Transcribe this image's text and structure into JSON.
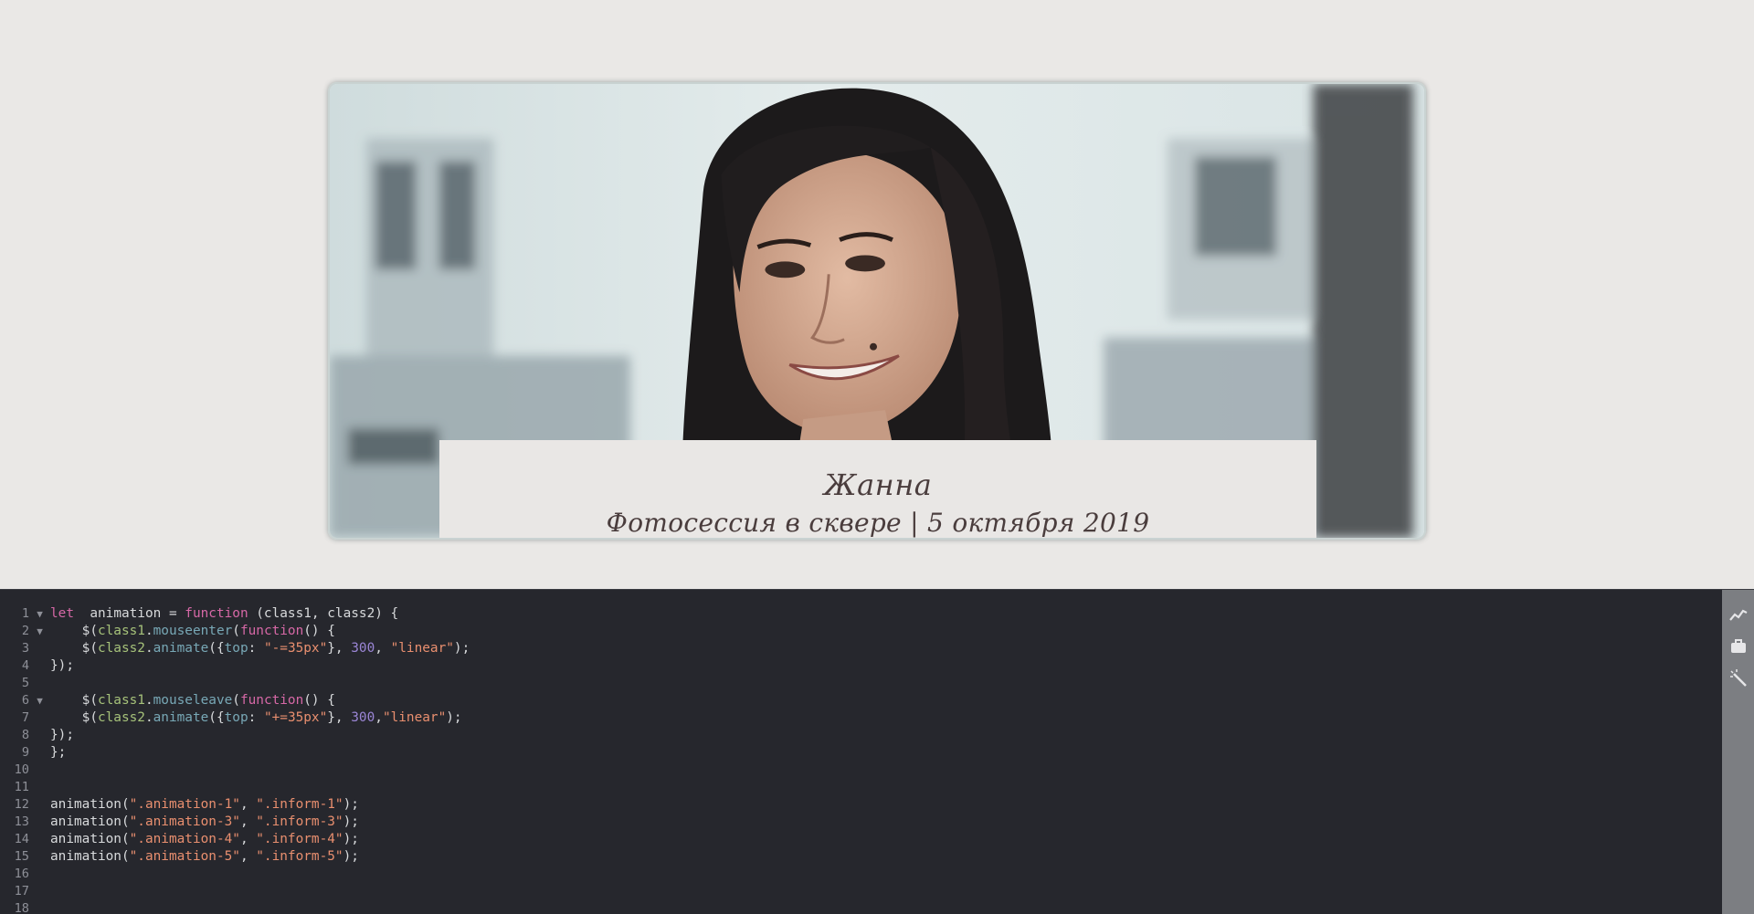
{
  "preview": {
    "name": "Жанна",
    "subtitle": "Фотосессия в сквере | 5 октября 2019"
  },
  "editor": {
    "lines": [
      {
        "n": "1",
        "fold": "▼",
        "tokens": [
          [
            "kw",
            "let"
          ],
          [
            "",
            "  animation = "
          ],
          [
            "kw",
            "function"
          ],
          [
            "",
            " (class1, class2) {"
          ]
        ]
      },
      {
        "n": "2",
        "fold": "▼",
        "tokens": [
          [
            "",
            "    $("
          ],
          [
            "var",
            "class1"
          ],
          [
            "",
            "."
          ],
          [
            "fn",
            "mouseenter"
          ],
          [
            "",
            "("
          ],
          [
            "kw",
            "function"
          ],
          [
            "",
            "() {"
          ]
        ]
      },
      {
        "n": "3",
        "fold": "",
        "tokens": [
          [
            "",
            "    $("
          ],
          [
            "var",
            "class2"
          ],
          [
            "",
            "."
          ],
          [
            "fn",
            "animate"
          ],
          [
            "",
            "({"
          ],
          [
            "prop",
            "top"
          ],
          [
            "",
            ": "
          ],
          [
            "str",
            "\"-=35px\""
          ],
          [
            "",
            "}, "
          ],
          [
            "num",
            "300"
          ],
          [
            "",
            ", "
          ],
          [
            "str",
            "\"linear\""
          ],
          [
            "",
            ");"
          ]
        ]
      },
      {
        "n": "4",
        "fold": "",
        "tokens": [
          [
            "",
            "});"
          ]
        ]
      },
      {
        "n": "5",
        "fold": "",
        "tokens": [
          [
            "",
            ""
          ]
        ]
      },
      {
        "n": "6",
        "fold": "▼",
        "tokens": [
          [
            "",
            "    $("
          ],
          [
            "var",
            "class1"
          ],
          [
            "",
            "."
          ],
          [
            "fn",
            "mouseleave"
          ],
          [
            "",
            "("
          ],
          [
            "kw",
            "function"
          ],
          [
            "",
            "() {"
          ]
        ]
      },
      {
        "n": "7",
        "fold": "",
        "tokens": [
          [
            "",
            "    $("
          ],
          [
            "var",
            "class2"
          ],
          [
            "",
            "."
          ],
          [
            "fn",
            "animate"
          ],
          [
            "",
            "({"
          ],
          [
            "prop",
            "top"
          ],
          [
            "",
            ": "
          ],
          [
            "str",
            "\"+=35px\""
          ],
          [
            "",
            "}, "
          ],
          [
            "num",
            "300"
          ],
          [
            "",
            ","
          ],
          [
            "str",
            "\"linear\""
          ],
          [
            "",
            ");"
          ]
        ]
      },
      {
        "n": "8",
        "fold": "",
        "tokens": [
          [
            "",
            "});"
          ]
        ]
      },
      {
        "n": "9",
        "fold": "",
        "tokens": [
          [
            "",
            "};"
          ]
        ]
      },
      {
        "n": "10",
        "fold": "",
        "tokens": [
          [
            "",
            ""
          ]
        ]
      },
      {
        "n": "11",
        "fold": "",
        "tokens": [
          [
            "",
            ""
          ]
        ]
      },
      {
        "n": "12",
        "fold": "",
        "tokens": [
          [
            "",
            "animation("
          ],
          [
            "str",
            "\".animation-1\""
          ],
          [
            "",
            ", "
          ],
          [
            "str",
            "\".inform-1\""
          ],
          [
            "",
            ");"
          ]
        ]
      },
      {
        "n": "13",
        "fold": "",
        "tokens": [
          [
            "",
            "animation("
          ],
          [
            "str",
            "\".animation-3\""
          ],
          [
            "",
            ", "
          ],
          [
            "str",
            "\".inform-3\""
          ],
          [
            "",
            ");"
          ]
        ]
      },
      {
        "n": "14",
        "fold": "",
        "tokens": [
          [
            "",
            "animation("
          ],
          [
            "str",
            "\".animation-4\""
          ],
          [
            "",
            ", "
          ],
          [
            "str",
            "\".inform-4\""
          ],
          [
            "",
            ");"
          ]
        ]
      },
      {
        "n": "15",
        "fold": "",
        "tokens": [
          [
            "",
            "animation("
          ],
          [
            "str",
            "\".animation-5\""
          ],
          [
            "",
            ", "
          ],
          [
            "str",
            "\".inform-5\""
          ],
          [
            "",
            ");"
          ]
        ]
      },
      {
        "n": "16",
        "fold": "",
        "tokens": [
          [
            "",
            ""
          ]
        ]
      },
      {
        "n": "17",
        "fold": "",
        "tokens": [
          [
            "",
            ""
          ]
        ]
      },
      {
        "n": "18",
        "fold": "",
        "tokens": [
          [
            "",
            ""
          ]
        ]
      }
    ],
    "tools": [
      "analytics-icon",
      "briefcase-icon",
      "magic-wand-icon"
    ]
  },
  "colors": {
    "editor_bg": "#26272d",
    "keyword": "#d668a6",
    "string": "#e98f6f",
    "number": "#9b86d6",
    "function": "#78a8b6",
    "variable": "#a6c27a"
  }
}
